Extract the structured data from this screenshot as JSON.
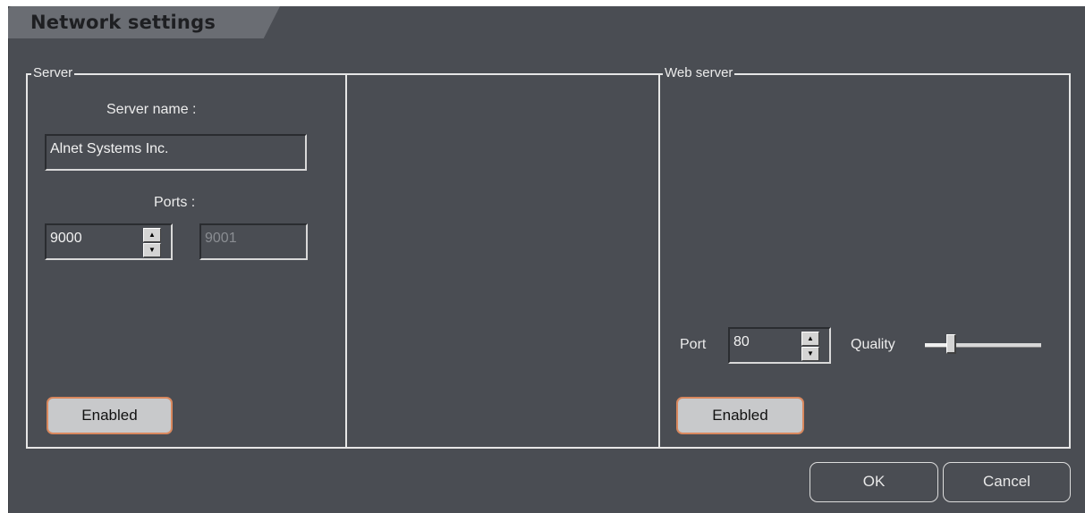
{
  "dialog": {
    "title": "Network settings"
  },
  "server": {
    "group_label": "Server",
    "server_name_label": "Server name :",
    "server_name_value": "Alnet Systems Inc.",
    "ports_label": "Ports :",
    "port1_value": "9000",
    "port2_value": "9001",
    "enabled_label": "Enabled"
  },
  "web_server": {
    "group_label": "Web server",
    "port_label": "Port",
    "port_value": "80",
    "quality_label": "Quality",
    "quality_level": 0.2,
    "enabled_label": "Enabled"
  },
  "footer": {
    "ok_label": "OK",
    "cancel_label": "Cancel"
  },
  "icons": {
    "spin_up": "▲",
    "spin_down": "▼"
  },
  "colors": {
    "accent": "#d9885e",
    "background": "#4a4d53"
  }
}
